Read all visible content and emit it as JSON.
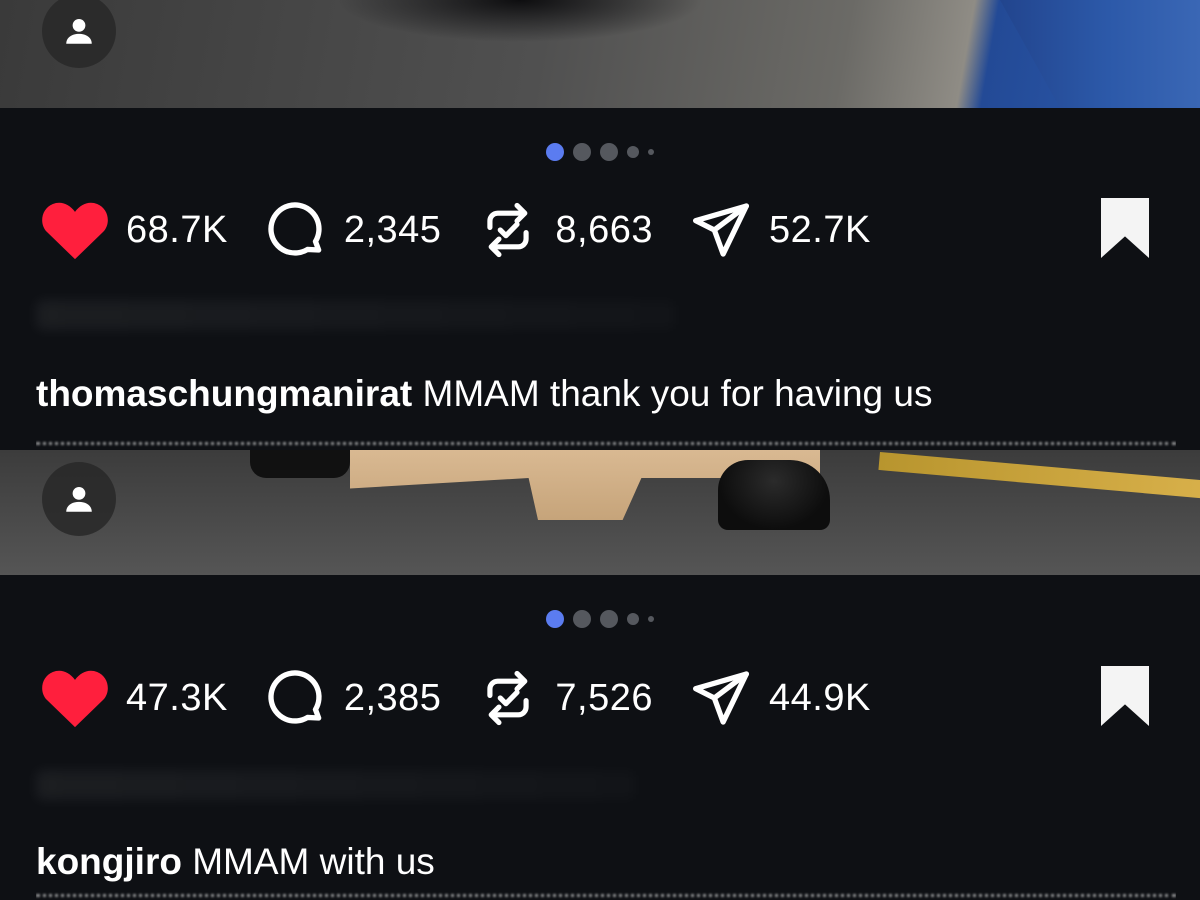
{
  "posts": [
    {
      "likes": "68.7K",
      "comments": "2,345",
      "reposts": "8,663",
      "shares": "52.7K",
      "username": "thomaschungmanirat",
      "caption": "MMAM thank you for having us"
    },
    {
      "likes": "47.3K",
      "comments": "2,385",
      "reposts": "7,526",
      "shares": "44.9K",
      "username": "kongjiro",
      "caption": "MMAM with us"
    }
  ],
  "carousel": {
    "total": 5,
    "active": 0,
    "active_color": "#5b7cf0",
    "inactive_color": "#55585e"
  },
  "colors": {
    "like": "#ff1f3d",
    "background": "#0e1014",
    "text": "#ffffff"
  },
  "icons": [
    "user-icon",
    "heart-icon",
    "comment-icon",
    "repost-icon",
    "share-icon",
    "bookmark-icon"
  ]
}
